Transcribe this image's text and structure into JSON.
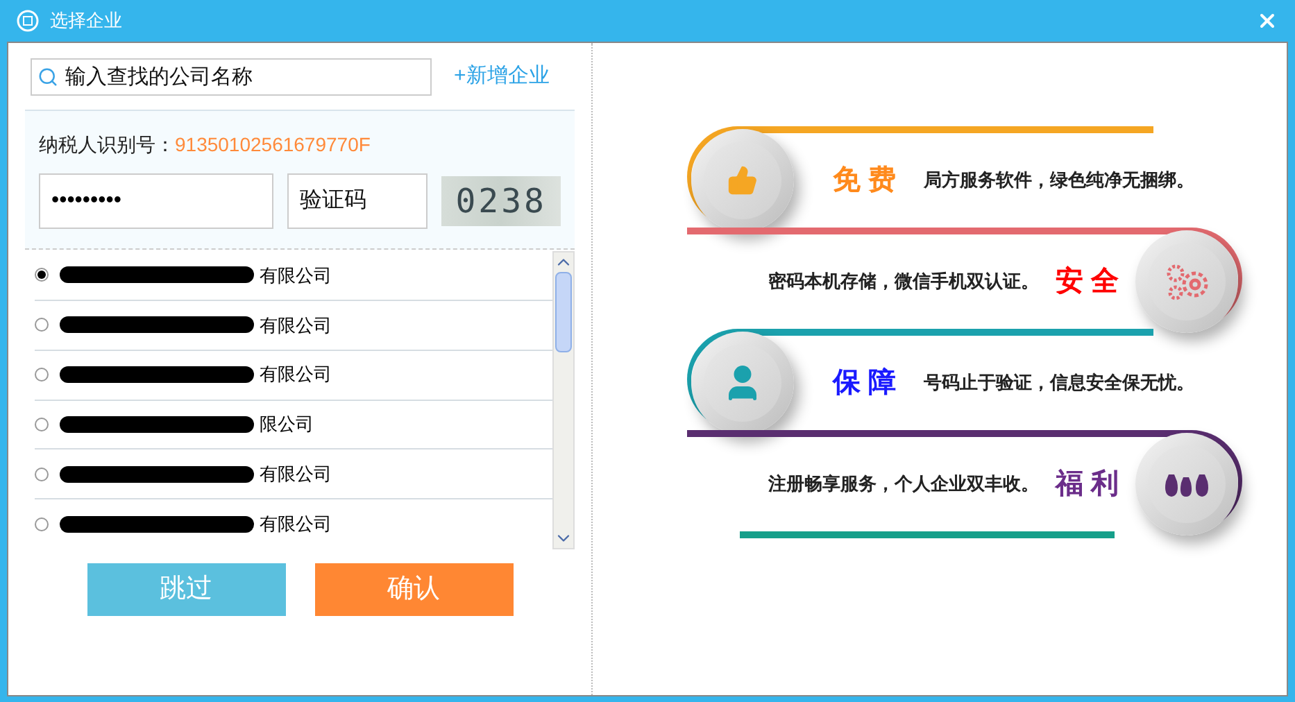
{
  "window": {
    "title": "选择企业"
  },
  "search": {
    "placeholder": "输入查找的公司名称"
  },
  "add_link": "+新增企业",
  "tax_id": {
    "label": "纳税人识别号：",
    "value": "91350102561679770F"
  },
  "password": {
    "value": "•••••••••"
  },
  "captcha_field": {
    "placeholder": "验证码"
  },
  "captcha": "0238",
  "companies": [
    {
      "name": "有限公司",
      "selected": true
    },
    {
      "name": "有限公司",
      "selected": false
    },
    {
      "name": "有限公司",
      "selected": false
    },
    {
      "name": "限公司",
      "selected": false
    },
    {
      "name": "有限公司",
      "selected": false
    },
    {
      "name": "有限公司",
      "selected": false
    }
  ],
  "buttons": [
    {
      "label": "跳过",
      "kind": "skip"
    },
    {
      "label": "确认",
      "kind": "confirm"
    }
  ],
  "features": [
    {
      "kind": "thumb",
      "title": "免 费",
      "text": "局方服务软件，绿色纯净无捆绑。",
      "color": "#f5a623"
    },
    {
      "kind": "gears",
      "title": "安 全",
      "text": "密码本机存储，微信手机双认证。",
      "color": "#e36a6f"
    },
    {
      "kind": "person",
      "title": "保 障",
      "text": "号码止于验证，信息安全保无忧。",
      "color": "#1ba1ad"
    },
    {
      "kind": "money",
      "title": "福 利",
      "text": "注册畅享服务，个人企业双丰收。",
      "color": "#5a2e70"
    }
  ]
}
